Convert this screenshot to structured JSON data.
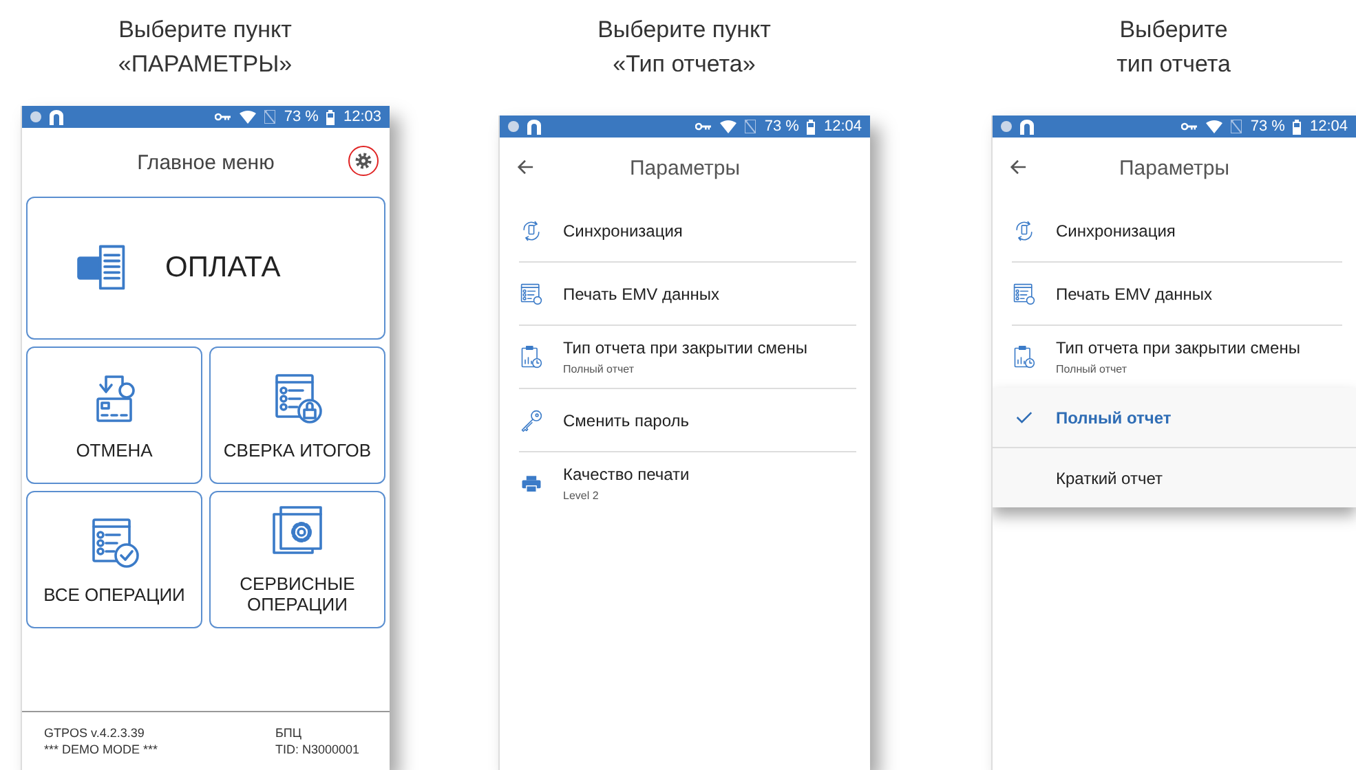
{
  "panels": [
    {
      "caption": "Выберите пункт\n«ПАРАМЕТРЫ»",
      "status_bar": {
        "battery": "73 %",
        "time": "12:03"
      },
      "screen": {
        "kind": "main_menu",
        "title": "Главное меню",
        "settings_button": {
          "highlighted": true
        },
        "tiles": [
          {
            "kind": "payment",
            "label": "ОПЛАТА"
          },
          {
            "kind": "refund",
            "label": "ОТМЕНА"
          },
          {
            "kind": "reconciliation",
            "label": "СВЕРКА ИТОГОВ"
          },
          {
            "kind": "operations",
            "label": "ВСЕ ОПЕРАЦИИ"
          },
          {
            "kind": "service",
            "label": "СЕРВИСНЫЕ ОПЕРАЦИИ"
          }
        ],
        "footer": {
          "left": [
            "GTPOS v.4.2.3.39",
            "*** DEMO MODE ***"
          ],
          "right": [
            "БПЦ",
            "TID: N3000001"
          ]
        }
      }
    },
    {
      "caption": "Выберите пункт\n«Тип отчета»",
      "status_bar": {
        "battery": "73 %",
        "time": "12:04"
      },
      "screen": {
        "kind": "settings",
        "title": "Параметры",
        "items": [
          {
            "kind": "sync",
            "label": "Синхронизация"
          },
          {
            "kind": "emv",
            "label": "Печать EMV данных"
          },
          {
            "kind": "report",
            "label": "Тип отчета при закрытии смены",
            "value": "Полный отчет"
          },
          {
            "kind": "password",
            "label": "Сменить пароль"
          },
          {
            "kind": "print_quality",
            "label": "Качество печати",
            "value": "Level 2"
          }
        ]
      }
    },
    {
      "caption": "Выберите\nтип отчета",
      "status_bar": {
        "battery": "73 %",
        "time": "12:04"
      },
      "screen": {
        "kind": "settings",
        "title": "Параметры",
        "items": [
          {
            "kind": "sync",
            "label": "Синхронизация"
          },
          {
            "kind": "emv",
            "label": "Печать EMV данных"
          },
          {
            "kind": "report",
            "label": "Тип отчета при закрытии смены",
            "value": "Полный отчет"
          }
        ],
        "popup": {
          "options": [
            {
              "label": "Полный отчет",
              "selected": true
            },
            {
              "label": "Краткий отчет",
              "selected": false
            }
          ]
        }
      }
    }
  ]
}
